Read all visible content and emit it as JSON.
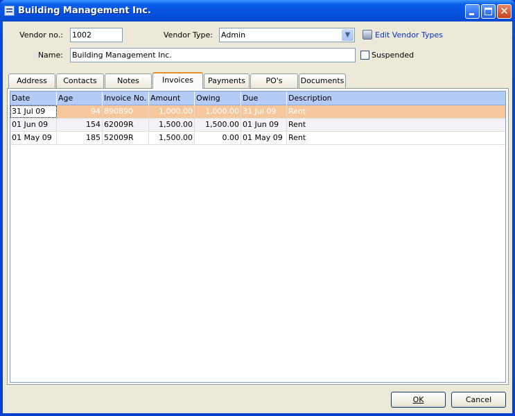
{
  "window": {
    "title": "Building Management Inc."
  },
  "form": {
    "vendor_no_label": "Vendor no.:",
    "vendor_no": "1002",
    "vendor_type_label": "Vendor Type:",
    "vendor_type": "Admin",
    "edit_vendor_types": "Edit Vendor Types",
    "name_label": "Name:",
    "name": "Building Management Inc.",
    "suspended_label": "Suspended",
    "suspended": false
  },
  "tabs": [
    {
      "label": "Address"
    },
    {
      "label": "Contacts"
    },
    {
      "label": "Notes"
    },
    {
      "label": "Invoices",
      "active": true
    },
    {
      "label": "Payments"
    },
    {
      "label": "PO's"
    },
    {
      "label": "Documents"
    }
  ],
  "grid": {
    "columns": [
      "Date",
      "Age",
      "Invoice No.",
      "Amount",
      "Owing",
      "Due",
      "Description"
    ],
    "rows": [
      [
        "31 Jul 09",
        "94",
        "890890",
        "1,000.00",
        "1,000.00",
        "31 Jul 09",
        "Rent"
      ],
      [
        "01 Jun 09",
        "154",
        "62009R",
        "1,500.00",
        "1,500.00",
        "01 Jun 09",
        "Rent"
      ],
      [
        "01 May 09",
        "185",
        "52009R",
        "1,500.00",
        "0.00",
        "01 May 09",
        "Rent"
      ]
    ]
  },
  "buttons": {
    "ok": "OK",
    "cancel": "Cancel"
  }
}
